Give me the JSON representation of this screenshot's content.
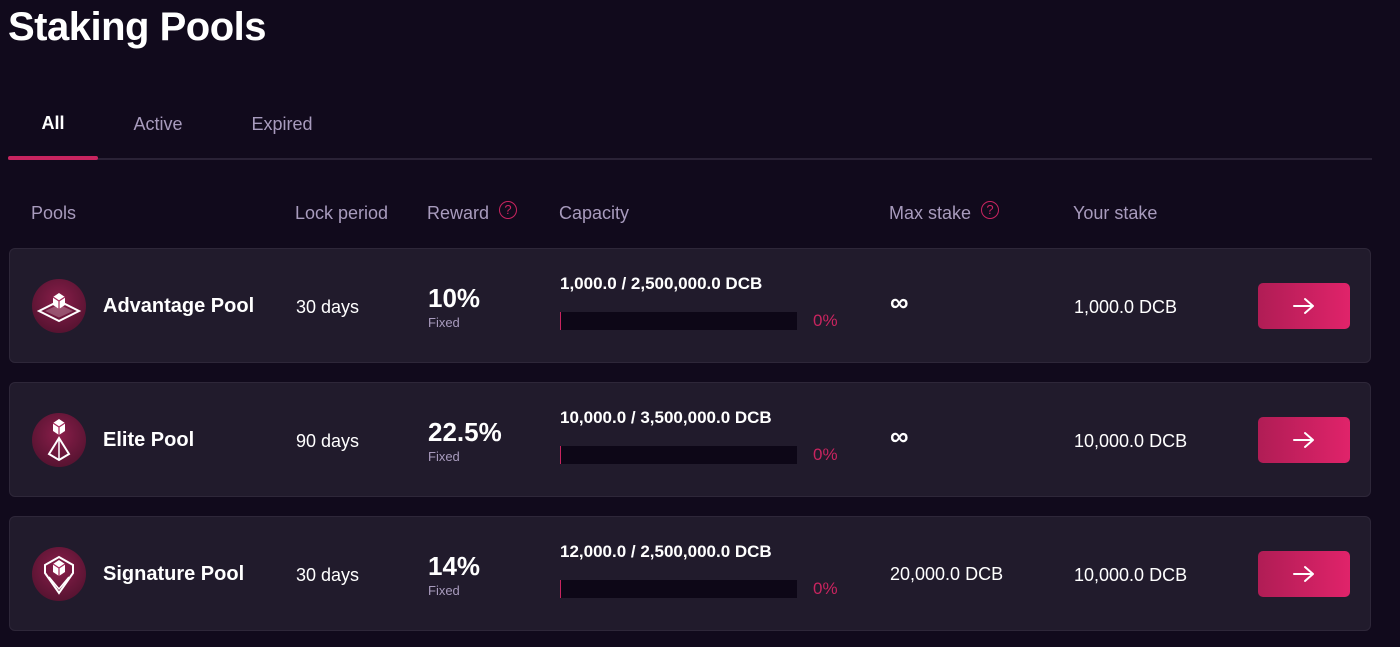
{
  "page": {
    "title": "Staking Pools"
  },
  "tabs": [
    {
      "label": "All",
      "active": true
    },
    {
      "label": "Active",
      "active": false
    },
    {
      "label": "Expired",
      "active": false
    }
  ],
  "columns": {
    "pools": "Pools",
    "lock_period": "Lock period",
    "reward": "Reward",
    "capacity": "Capacity",
    "max_stake": "Max stake",
    "your_stake": "Your stake",
    "help_glyph": "?"
  },
  "pools": [
    {
      "name": "Advantage Pool",
      "icon": "advantage-pool-icon",
      "lock_period": "30 days",
      "reward": "10%",
      "reward_type": "Fixed",
      "capacity_text": "1,000.0 / 2,500,000.0 DCB",
      "capacity_percent": "0%",
      "capacity_fill": 0.0004,
      "max_stake": "∞",
      "your_stake": "1,000.0 DCB"
    },
    {
      "name": "Elite Pool",
      "icon": "elite-pool-icon",
      "lock_period": "90 days",
      "reward": "22.5%",
      "reward_type": "Fixed",
      "capacity_text": "10,000.0 / 3,500,000.0 DCB",
      "capacity_percent": "0%",
      "capacity_fill": 0.0029,
      "max_stake": "∞",
      "your_stake": "10,000.0 DCB"
    },
    {
      "name": "Signature Pool",
      "icon": "signature-pool-icon",
      "lock_period": "30 days",
      "reward": "14%",
      "reward_type": "Fixed",
      "capacity_text": "12,000.0 / 2,500,000.0 DCB",
      "capacity_percent": "0%",
      "capacity_fill": 0.0048,
      "max_stake": "20,000.0 DCB",
      "your_stake": "10,000.0 DCB"
    }
  ],
  "colors": {
    "background": "#110a1c",
    "row": "#211b2c",
    "accent": "#c8245f",
    "muted_text": "#a89bbd"
  }
}
